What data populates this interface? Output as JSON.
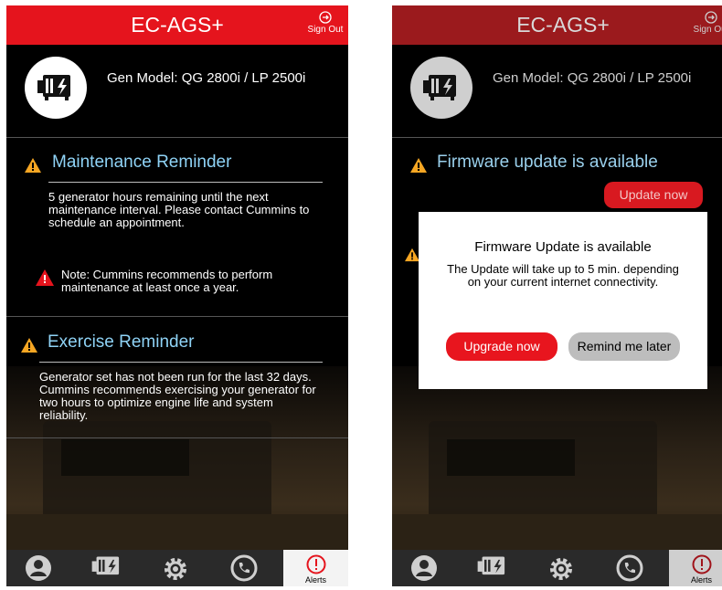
{
  "left": {
    "header": {
      "title": "EC-AGS+",
      "sign_out": "Sign Out"
    },
    "gen_model": "Gen Model: QG 2800i / LP 2500i",
    "maintenance": {
      "title": "Maintenance Reminder",
      "text": "5 generator hours remaining until the next maintenance interval. Please contact Cummins to schedule an appointment.",
      "note": "Note: Cummins recommends to perform maintenance at least once a year."
    },
    "exercise": {
      "title": "Exercise Reminder",
      "text": "Generator set has not been run for the last 32 days. Cummins recommends exercising your generator for two hours to optimize engine life and system reliability."
    },
    "nav": {
      "alerts_label": "Alerts"
    }
  },
  "right": {
    "header": {
      "title": "EC-AGS+",
      "sign_out": "Sign Out"
    },
    "gen_model": "Gen Model: QG 2800i / LP 2500i",
    "firmware": {
      "title": "Firmware update is available",
      "update_button": "Update now"
    },
    "modal": {
      "title": "Firmware Update is available",
      "body": "The Update will take up to 5 min. depending on your current internet connectivity.",
      "upgrade_button": "Upgrade now",
      "remind_button": "Remind me later"
    },
    "nav": {
      "alerts_label": "Alerts"
    }
  },
  "colors": {
    "header_red": "#e5141d",
    "header_dim": "#9b1a1d",
    "title_blue": "#8fd3f6",
    "warning_orange": "#f6a623",
    "button_red": "#e8151e"
  },
  "icons": [
    "sign-out-icon",
    "generator-icon",
    "warning-icon",
    "alert-icon",
    "profile-icon",
    "gear-icon",
    "phone-icon",
    "alerts-icon"
  ]
}
